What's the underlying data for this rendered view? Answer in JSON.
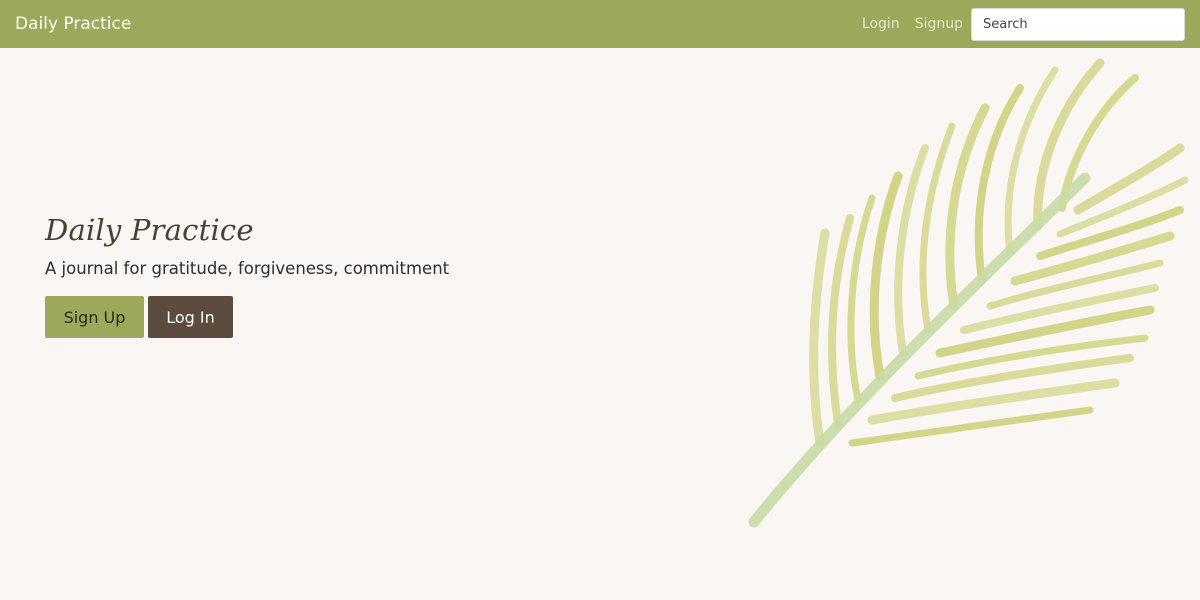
{
  "navbar": {
    "brand": "Daily Practice",
    "links": [
      {
        "label": "Login"
      },
      {
        "label": "Signup"
      }
    ],
    "search": {
      "placeholder": "Search",
      "value": ""
    }
  },
  "hero": {
    "title": "Daily Practice",
    "subtitle": "A journal for gratitude, forgiveness, commitment",
    "buttons": {
      "signup": "Sign Up",
      "login": "Log In"
    }
  },
  "colors": {
    "navbar_bg": "#9ca85a",
    "page_bg": "#f9f6f3",
    "signup_button": "#9ca85a",
    "login_button": "#5b4c3d",
    "leaf_stem": "#c8dba6",
    "leaf_fronds": "#cdd17a"
  },
  "decorations": {
    "illustration": "watercolor-palm-leaf"
  }
}
